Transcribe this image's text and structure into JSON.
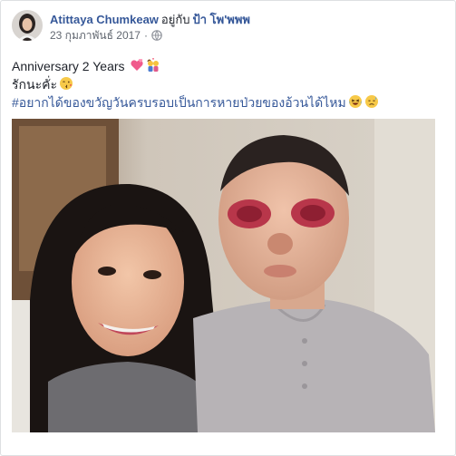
{
  "post": {
    "author": "Atittaya Chumkeaw",
    "with_text": "อยู่กับ",
    "tagged_friend": "ป้า โพ'พพพ",
    "date": "23 กุมภาพันธ์ 2017",
    "separator": "·",
    "privacy_icon": "globe-icon",
    "text_line1": "Anniversary 2 Years",
    "text_line1_emojis": [
      "hearts-emoji",
      "couple-kiss-emoji"
    ],
    "text_line2": "รักนะคั่ะ",
    "text_line2_emojis": [
      "kissing-face-emoji"
    ],
    "hashtag": "#อยากได้ของขวัญวันครบรอบเป็นการหายป่วยของอ้วนได้ไหม",
    "hashtag_emojis": [
      "laughing-tears-emoji",
      "sad-face-emoji"
    ]
  },
  "colors": {
    "link": "#365899",
    "text": "#1d2129",
    "meta": "#616770",
    "border": "#dddfe2"
  }
}
